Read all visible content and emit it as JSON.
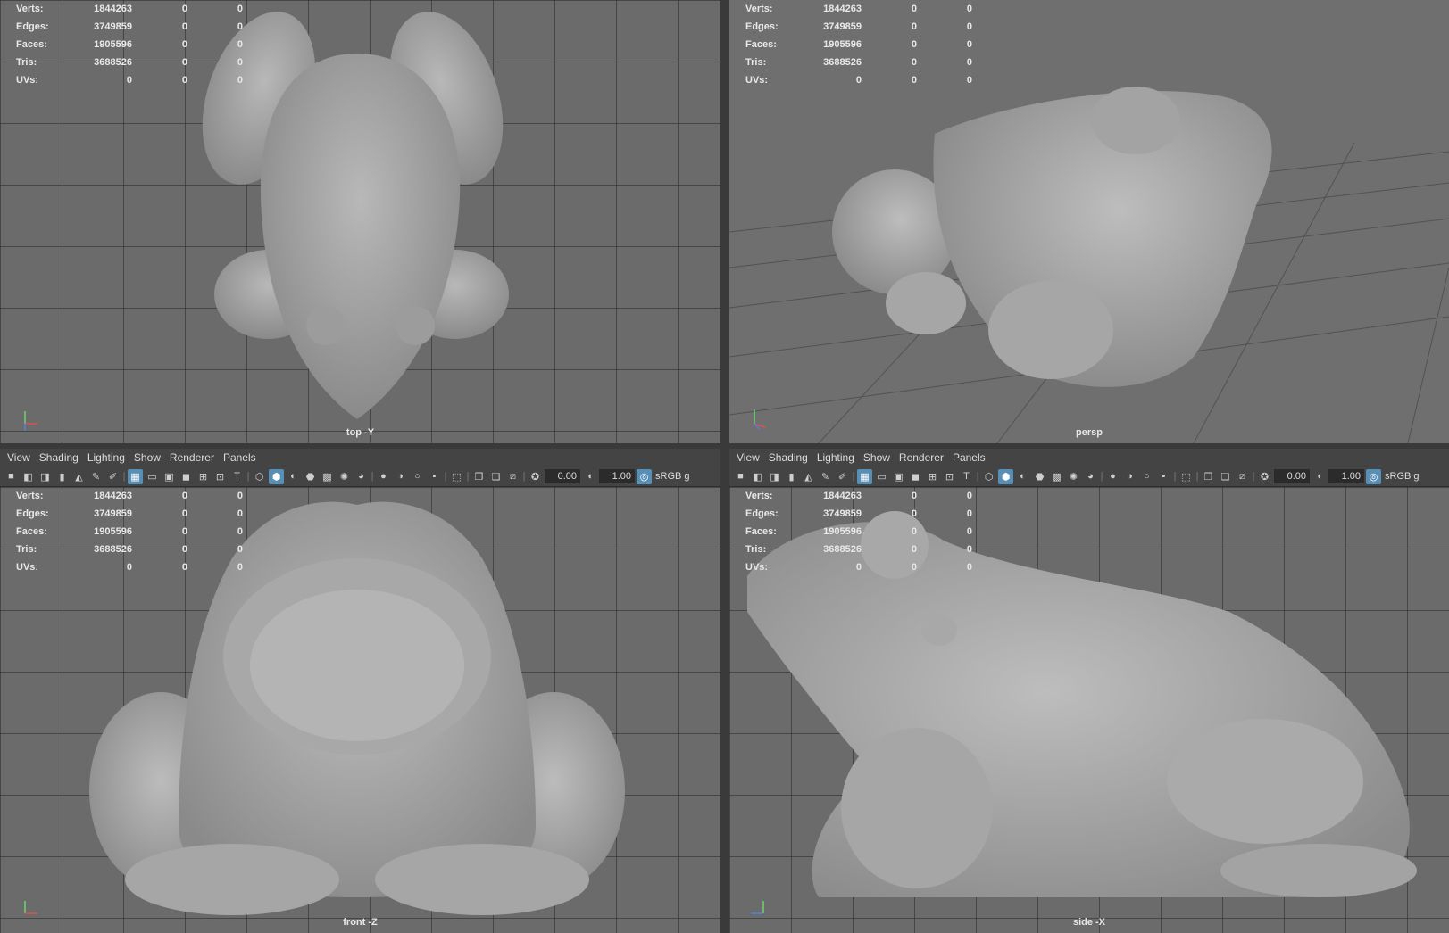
{
  "menu": [
    "View",
    "Shading",
    "Lighting",
    "Show",
    "Renderer",
    "Panels"
  ],
  "toolbar": {
    "exposure": "0.00",
    "gamma": "1.00",
    "colorspace": "sRGB g"
  },
  "hud_rows": [
    {
      "label": "Verts:",
      "v1": "1844263",
      "v2": "0",
      "v3": "0"
    },
    {
      "label": "Edges:",
      "v1": "3749859",
      "v2": "0",
      "v3": "0"
    },
    {
      "label": "Faces:",
      "v1": "1905596",
      "v2": "0",
      "v3": "0"
    },
    {
      "label": "Tris:",
      "v1": "3688526",
      "v2": "0",
      "v3": "0"
    },
    {
      "label": "UVs:",
      "v1": "0",
      "v2": "0",
      "v3": "0"
    }
  ],
  "viewports": {
    "top": {
      "camera": "top -Y"
    },
    "persp": {
      "camera": "persp"
    },
    "front": {
      "camera": "front -Z"
    },
    "side": {
      "camera": "side -X"
    }
  },
  "colors": {
    "grid_bg": "#6b6b6b",
    "mesh": "#a9a9a9",
    "toolbar_bg": "#444444",
    "active_icon": "#5a8fb5"
  }
}
